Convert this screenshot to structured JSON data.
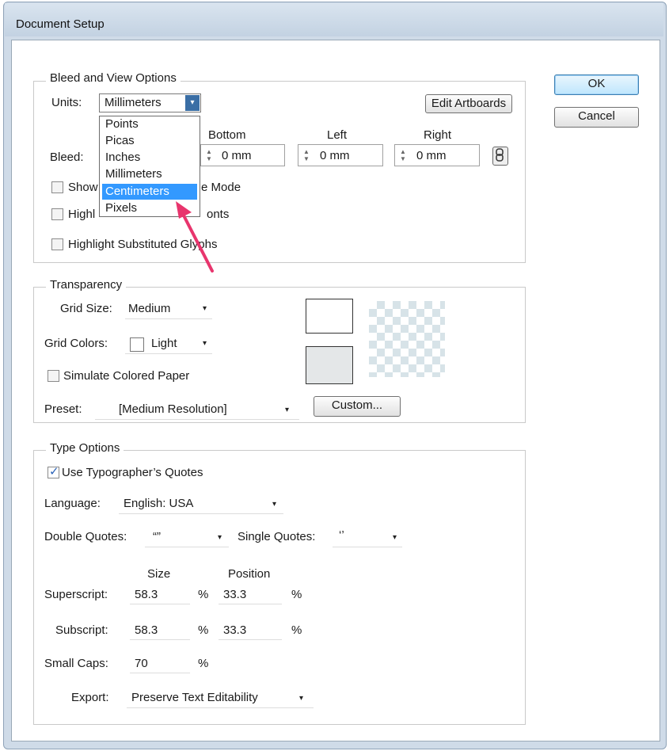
{
  "window": {
    "title": "Document Setup"
  },
  "actions": {
    "ok_label": "OK",
    "cancel_label": "Cancel"
  },
  "bleed_view": {
    "legend": "Bleed and View Options",
    "units_label": "Units:",
    "units_value": "Millimeters",
    "edit_artboards_label": "Edit Artboards",
    "bleed_label": "Bleed:",
    "columns": {
      "bottom": "Bottom",
      "left": "Left",
      "right": "Right"
    },
    "bottom_value": "0 mm",
    "left_value": "0 mm",
    "right_value": "0 mm",
    "options": {
      "show_images_visible_text": "Show",
      "show_images_partial_text": "e Mode",
      "highlight_fonts_visible_start": "Highl",
      "highlight_fonts_visible_end": "onts",
      "highlight_glyphs_label": "Highlight Substituted Glyphs"
    }
  },
  "units_dropdown": {
    "items": [
      "Points",
      "Picas",
      "Inches",
      "Millimeters",
      "Centimeters",
      "Pixels"
    ],
    "selected_index": 4
  },
  "transparency": {
    "legend": "Transparency",
    "grid_size_label": "Grid Size:",
    "grid_size_value": "Medium",
    "grid_colors_label": "Grid Colors:",
    "grid_colors_value": "Light",
    "simulate_paper_label": "Simulate Colored Paper",
    "preset_label": "Preset:",
    "preset_value": "[Medium Resolution]",
    "custom_label": "Custom..."
  },
  "type_options": {
    "legend": "Type Options",
    "typographers_quotes_label": "Use Typographer’s Quotes",
    "typographers_quotes_checked": true,
    "language_label": "Language:",
    "language_value": "English: USA",
    "double_quotes_label": "Double Quotes:",
    "double_quotes_value": "“”",
    "single_quotes_label": "Single Quotes:",
    "single_quotes_value": "‘’",
    "size_header": "Size",
    "position_header": "Position",
    "superscript_label": "Superscript:",
    "superscript_size": "58.3",
    "superscript_position": "33.3",
    "subscript_label": "Subscript:",
    "subscript_size": "58.3",
    "subscript_position": "33.3",
    "small_caps_label": "Small Caps:",
    "small_caps_value": "70",
    "percent": "%",
    "export_label": "Export:",
    "export_value": "Preserve Text Editability"
  },
  "icons": {
    "dropdown_arrow": "▾",
    "spinner": "spinner-arrows-icon",
    "link": "chain-link-icon",
    "annotation": "red-arrow-pointer-icon",
    "checkmark": "✓"
  },
  "colors": {
    "selection": "#3399ff",
    "annotation_arrow": "#e8356d",
    "checkmark": "#2a62b8"
  }
}
